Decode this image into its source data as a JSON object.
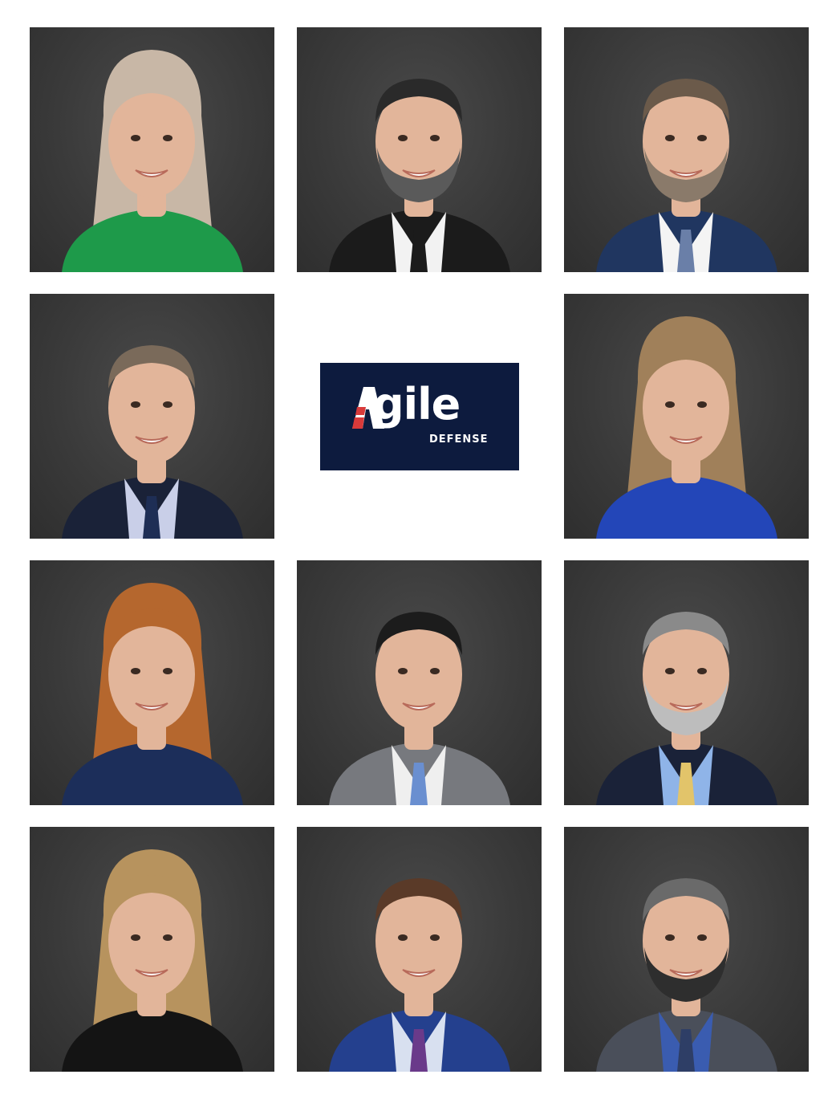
{
  "logo": {
    "word": "gile",
    "sub": "DEFENSE",
    "colors": {
      "background": "#0d1b3e",
      "accent": "#d93a3a",
      "text": "#ffffff"
    }
  },
  "portraits": [
    {
      "hair": "#c8b7a6",
      "long_hair": true,
      "beard": null,
      "top": "#1e9a4a",
      "tie": null,
      "shirt": null
    },
    {
      "hair": "#2a2a2a",
      "long_hair": false,
      "beard": "#5a5a5a",
      "top": "#1b1b1b",
      "tie": "#1b1b1b",
      "shirt": "#f2f2f2"
    },
    {
      "hair": "#6b5a4a",
      "long_hair": false,
      "beard": "#8a7a6a",
      "top": "#203660",
      "tie": "#6a7fa8",
      "shirt": "#f4f4f4"
    },
    {
      "hair": "#7a6a5a",
      "long_hair": false,
      "beard": null,
      "top": "#1a2238",
      "tie": "#1e2e55",
      "shirt": "#c9cfe8"
    },
    {
      "hair": "#a0805a",
      "long_hair": true,
      "beard": null,
      "top": "#2346b8",
      "tie": null,
      "shirt": null
    },
    {
      "hair": "#b5672e",
      "long_hair": true,
      "beard": null,
      "top": "#1c2e5a",
      "tie": null,
      "shirt": null
    },
    {
      "hair": "#1c1c1c",
      "long_hair": false,
      "beard": null,
      "top": "#77797e",
      "tie": "#6a8fd0",
      "shirt": "#efefef"
    },
    {
      "hair": "#8a8a8a",
      "long_hair": false,
      "beard": "#bdbdbd",
      "top": "#1a2238",
      "tie": "#e2c46a",
      "shirt": "#8fb4e8"
    },
    {
      "hair": "#b7935e",
      "long_hair": true,
      "beard": null,
      "top": "#141414",
      "tie": null,
      "shirt": null
    },
    {
      "hair": "#5a3a28",
      "long_hair": false,
      "beard": null,
      "top": "#24408e",
      "tie": "#6a3a8a",
      "shirt": "#d8e0f0"
    },
    {
      "hair": "#6a6a6a",
      "long_hair": false,
      "beard": "#2e2e2e",
      "top": "#4a4f5a",
      "tie": "#2e3e66",
      "shirt": "#3a5cb0"
    }
  ]
}
